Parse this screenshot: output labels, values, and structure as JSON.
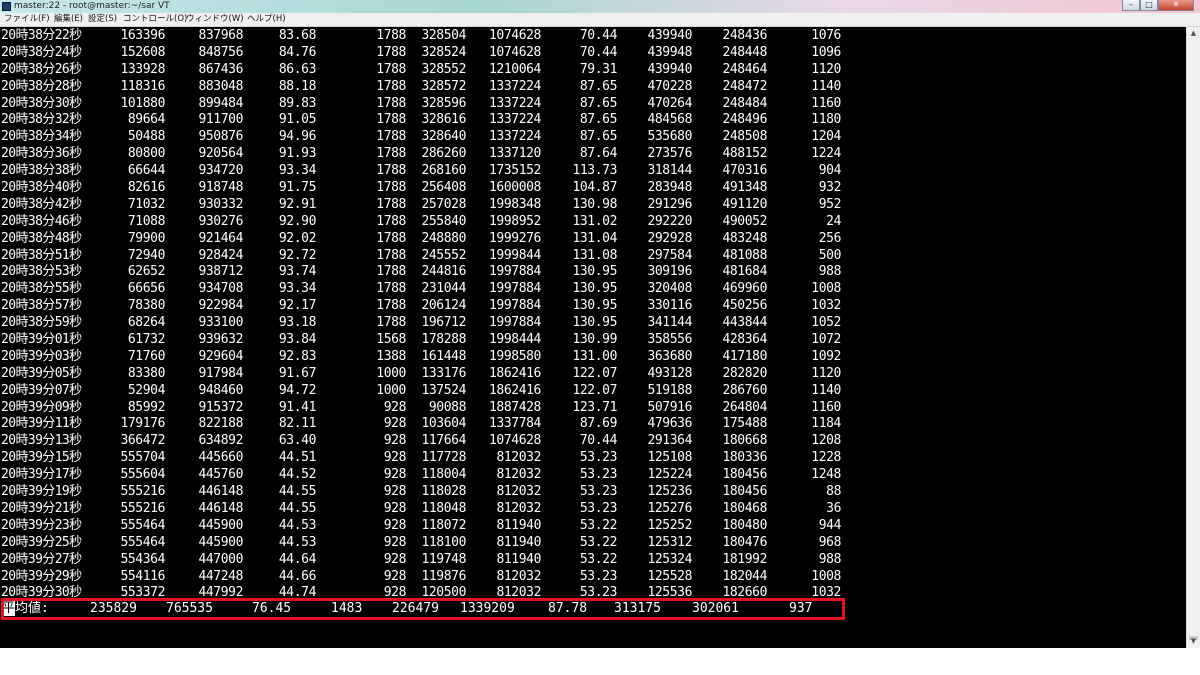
{
  "window": {
    "title": "master:22 - root@master:~/sar VT"
  },
  "menu": [
    "ファイル(F)",
    "編集(E)",
    "設定(S)",
    "コントロール(O)",
    "ウィンドウ(W)",
    "ヘルプ(H)"
  ],
  "rows": [
    [
      "20時38分22秒",
      "163396",
      "837968",
      "83.68",
      "1788",
      "328504",
      "1074628",
      "70.44",
      "439940",
      "248436",
      "1076"
    ],
    [
      "20時38分24秒",
      "152608",
      "848756",
      "84.76",
      "1788",
      "328524",
      "1074628",
      "70.44",
      "439948",
      "248448",
      "1096"
    ],
    [
      "20時38分26秒",
      "133928",
      "867436",
      "86.63",
      "1788",
      "328552",
      "1210064",
      "79.31",
      "439940",
      "248464",
      "1120"
    ],
    [
      "20時38分28秒",
      "118316",
      "883048",
      "88.18",
      "1788",
      "328572",
      "1337224",
      "87.65",
      "470228",
      "248472",
      "1140"
    ],
    [
      "20時38分30秒",
      "101880",
      "899484",
      "89.83",
      "1788",
      "328596",
      "1337224",
      "87.65",
      "470264",
      "248484",
      "1160"
    ],
    [
      "20時38分32秒",
      "89664",
      "911700",
      "91.05",
      "1788",
      "328616",
      "1337224",
      "87.65",
      "484568",
      "248496",
      "1180"
    ],
    [
      "20時38分34秒",
      "50488",
      "950876",
      "94.96",
      "1788",
      "328640",
      "1337224",
      "87.65",
      "535680",
      "248508",
      "1204"
    ],
    [
      "20時38分36秒",
      "80800",
      "920564",
      "91.93",
      "1788",
      "286260",
      "1337120",
      "87.64",
      "273576",
      "488152",
      "1224"
    ],
    [
      "20時38分38秒",
      "66644",
      "934720",
      "93.34",
      "1788",
      "268160",
      "1735152",
      "113.73",
      "318144",
      "470316",
      "904"
    ],
    [
      "20時38分40秒",
      "82616",
      "918748",
      "91.75",
      "1788",
      "256408",
      "1600008",
      "104.87",
      "283948",
      "491348",
      "932"
    ],
    [
      "20時38分42秒",
      "71032",
      "930332",
      "92.91",
      "1788",
      "257028",
      "1998348",
      "130.98",
      "291296",
      "491120",
      "952"
    ],
    [
      "20時38分46秒",
      "71088",
      "930276",
      "92.90",
      "1788",
      "255840",
      "1998952",
      "131.02",
      "292220",
      "490052",
      "24"
    ],
    [
      "20時38分48秒",
      "79900",
      "921464",
      "92.02",
      "1788",
      "248880",
      "1999276",
      "131.04",
      "292928",
      "483248",
      "256"
    ],
    [
      "20時38分51秒",
      "72940",
      "928424",
      "92.72",
      "1788",
      "245552",
      "1999844",
      "131.08",
      "297584",
      "481088",
      "500"
    ],
    [
      "20時38分53秒",
      "62652",
      "938712",
      "93.74",
      "1788",
      "244816",
      "1997884",
      "130.95",
      "309196",
      "481684",
      "988"
    ],
    [
      "20時38分55秒",
      "66656",
      "934708",
      "93.34",
      "1788",
      "231044",
      "1997884",
      "130.95",
      "320408",
      "469960",
      "1008"
    ],
    [
      "20時38分57秒",
      "78380",
      "922984",
      "92.17",
      "1788",
      "206124",
      "1997884",
      "130.95",
      "330116",
      "450256",
      "1032"
    ],
    [
      "20時38分59秒",
      "68264",
      "933100",
      "93.18",
      "1788",
      "196712",
      "1997884",
      "130.95",
      "341144",
      "443844",
      "1052"
    ],
    [
      "20時39分01秒",
      "61732",
      "939632",
      "93.84",
      "1568",
      "178288",
      "1998444",
      "130.99",
      "358556",
      "428364",
      "1072"
    ],
    [
      "20時39分03秒",
      "71760",
      "929604",
      "92.83",
      "1388",
      "161448",
      "1998580",
      "131.00",
      "363680",
      "417180",
      "1092"
    ],
    [
      "20時39分05秒",
      "83380",
      "917984",
      "91.67",
      "1000",
      "133176",
      "1862416",
      "122.07",
      "493128",
      "282820",
      "1120"
    ],
    [
      "20時39分07秒",
      "52904",
      "948460",
      "94.72",
      "1000",
      "137524",
      "1862416",
      "122.07",
      "519188",
      "286760",
      "1140"
    ],
    [
      "20時39分09秒",
      "85992",
      "915372",
      "91.41",
      "928",
      "90088",
      "1887428",
      "123.71",
      "507916",
      "264804",
      "1160"
    ],
    [
      "20時39分11秒",
      "179176",
      "822188",
      "82.11",
      "928",
      "103604",
      "1337784",
      "87.69",
      "479636",
      "175488",
      "1184"
    ],
    [
      "20時39分13秒",
      "366472",
      "634892",
      "63.40",
      "928",
      "117664",
      "1074628",
      "70.44",
      "291364",
      "180668",
      "1208"
    ],
    [
      "20時39分15秒",
      "555704",
      "445660",
      "44.51",
      "928",
      "117728",
      "812032",
      "53.23",
      "125108",
      "180336",
      "1228"
    ],
    [
      "20時39分17秒",
      "555604",
      "445760",
      "44.52",
      "928",
      "118004",
      "812032",
      "53.23",
      "125224",
      "180456",
      "1248"
    ],
    [
      "20時39分19秒",
      "555216",
      "446148",
      "44.55",
      "928",
      "118028",
      "812032",
      "53.23",
      "125236",
      "180456",
      "88"
    ],
    [
      "20時39分21秒",
      "555216",
      "446148",
      "44.55",
      "928",
      "118048",
      "812032",
      "53.23",
      "125276",
      "180468",
      "36"
    ],
    [
      "20時39分23秒",
      "555464",
      "445900",
      "44.53",
      "928",
      "118072",
      "811940",
      "53.22",
      "125252",
      "180480",
      "944"
    ],
    [
      "20時39分25秒",
      "555464",
      "445900",
      "44.53",
      "928",
      "118100",
      "811940",
      "53.22",
      "125312",
      "180476",
      "968"
    ],
    [
      "20時39分27秒",
      "554364",
      "447000",
      "44.64",
      "928",
      "119748",
      "811940",
      "53.22",
      "125324",
      "181992",
      "988"
    ],
    [
      "20時39分29秒",
      "554116",
      "447248",
      "44.66",
      "928",
      "119876",
      "812032",
      "53.23",
      "125528",
      "182044",
      "1008"
    ],
    [
      "20時39分30秒",
      "553372",
      "447992",
      "44.74",
      "928",
      "120500",
      "812032",
      "53.23",
      "125536",
      "182660",
      "1032"
    ]
  ],
  "average": {
    "cursor_char": "平",
    "label_rest": "均値:",
    "values": [
      "235829",
      "765535",
      "76.45",
      "1483",
      "226479",
      "1339209",
      "87.78",
      "313175",
      "302061",
      "937"
    ]
  },
  "colors": {
    "terminal_bg": "#000000",
    "terminal_fg": "#ffffff",
    "highlight": "#e5141c"
  }
}
